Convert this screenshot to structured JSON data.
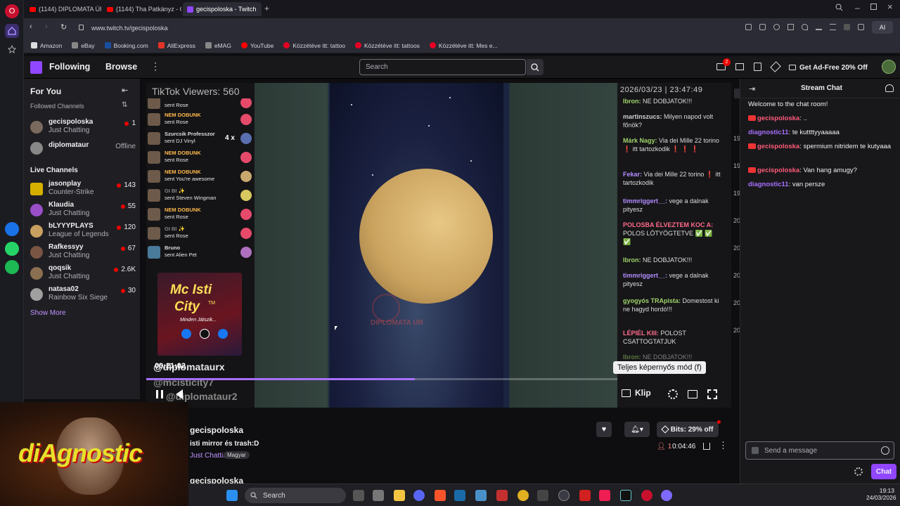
{
  "browser": {
    "tabs": [
      {
        "label": "(1144) DIPLOMATA ÚR - Y"
      },
      {
        "label": "(1144) Tha Patkányz - Gor"
      },
      {
        "label": "gecispoloska - Twitch"
      }
    ],
    "url": "www.twitch.tv/gecispoloska",
    "bookmarks": [
      "Amazon",
      "eBay",
      "Booking.com",
      "AliExpress",
      "eMAG",
      "YouTube",
      "Közzétéve itt: tattoo",
      "Közzétéve itt: tattoos",
      "Közzétéve itt: Mes e..."
    ],
    "toolbar_ai": "AI"
  },
  "twitch_nav": {
    "following": "Following",
    "browse": "Browse",
    "search_placeholder": "Search",
    "notif_count": "2",
    "ad_free": "Get Ad-Free 20% Off"
  },
  "sidebar": {
    "for_you": "For You",
    "followed_header": "Followed Channels",
    "followed": [
      {
        "name": "gecispoloska",
        "game": "Just Chatting",
        "viewers": "1",
        "color": "#7a6a5e"
      },
      {
        "name": "diplomataur",
        "game": "",
        "viewers": "Offline",
        "color": "#888888"
      }
    ],
    "live_header": "Live Channels",
    "live": [
      {
        "name": "jasonplay",
        "game": "Counter-Strike",
        "viewers": "143",
        "color": "#d6b000"
      },
      {
        "name": "Klaudia",
        "game": "Just Chatting",
        "viewers": "55",
        "color": "#9a4fc9"
      },
      {
        "name": "bLYYYPLAYS",
        "game": "League of Legends",
        "viewers": "120",
        "color": "#c9a060"
      },
      {
        "name": "Rafkessyy",
        "game": "Just Chatting",
        "viewers": "67",
        "color": "#7a5544"
      },
      {
        "name": "qoqsik",
        "game": "Just Chatting",
        "viewers": "2.6K",
        "color": "#8a7050"
      },
      {
        "name": "natasa02",
        "game": "Rainbow Six Siege",
        "viewers": "30",
        "color": "#a0a0a0"
      }
    ],
    "show_more": "Show More"
  },
  "player": {
    "tiktok_viewers": "TikTok Viewers: 560",
    "datetime": "2026/03/23 | 23:47:49",
    "gifts": [
      {
        "name": "",
        "text": "sent Rose"
      },
      {
        "name": "NEM DOBUNK",
        "text": "sent Rose"
      },
      {
        "name": "Szurcsik Professzor",
        "text": "sent DJ Vinyl",
        "count": "4 x"
      },
      {
        "name": "NEM DOBUNK",
        "text": "sent Rose"
      },
      {
        "name": "NEM DOBUNK",
        "text": "sent You're awesome"
      },
      {
        "name": "GI BI ✨",
        "text": "sent Steven Wingman"
      },
      {
        "name": "NEM DOBUNK",
        "text": "sent Rose"
      },
      {
        "name": "GI BI ✨",
        "text": "sent Rose"
      },
      {
        "name": "Bruno",
        "text": "sent Alien Pet"
      }
    ],
    "promo_title_1": "Mc Isti",
    "promo_title_2": "City",
    "promo_tm": "TM",
    "promo_sub": "Minden Játszik...",
    "handle1": "@diplomataurx",
    "handle2": "@mcisticity7",
    "handle3": "@diplomataur2",
    "timer": "00:21:02",
    "watermark": "DIPLOMATA ÚR",
    "progress_pct": 57,
    "overlay_chat": [
      {
        "user": "Ibron:",
        "text": "NE DOBJATOK!!!",
        "ucolor": "#9fd36b"
      },
      {
        "user": "martinszucs:",
        "text": "Milyen napod volt főnök?",
        "ucolor": "#cfcfcf"
      },
      {
        "user": "Márk Nagy:",
        "text": "Via dei Mille 22 torino ❗ itt tartozkodik ❗ ❗ ❗",
        "ucolor": "#9fd36b"
      },
      {
        "user": "Fekar:",
        "text": "Via dei Mille 22 torino ❗ itt tartozkodik",
        "ucolor": "#b38cff"
      },
      {
        "user": "timmriggert__:",
        "text": "vege a dalnak pityesz",
        "ucolor": "#b38cff"
      },
      {
        "user": "POLOSBA ÉLVEZTEM KOC A:",
        "text": "POLOS LÖTYÖGTETVE ✅ ✅ ✅",
        "ucolor": "#ff6a8a"
      },
      {
        "user": "Ibron:",
        "text": "NE DOBJATOK!!!",
        "ucolor": "#9fd36b"
      },
      {
        "user": "timmriggert__:",
        "text": "vege a dalnak pityesz",
        "ucolor": "#b38cff"
      },
      {
        "user": "gyogyós TRApista:",
        "text": "Domestost ki ne hagyd hordó!!!",
        "ucolor": "#9fd36b"
      },
      {
        "user": "LÉPIÉL KIII:",
        "text": "POLOST CSATTOGTATJUK",
        "ucolor": "#ff6a8a"
      },
      {
        "user": "Ibron:",
        "text": "NE DOBJATOK!!!",
        "ucolor": "#9fd36b"
      }
    ],
    "tooltip": "Teljes képernyős mód (f)",
    "klip": "Klip"
  },
  "stream_info": {
    "channel": "gecispoloska",
    "title": "isti mirror és trash:D",
    "category": "Just Chatting",
    "tag": "Magyar",
    "bits": "Bits: 29% off",
    "viewers": "1",
    "uptime": "0:04:46",
    "channel2": "gecispoloska"
  },
  "chat": {
    "title": "Stream Chat",
    "welcome": "Welcome to the chat room!",
    "messages": [
      {
        "user": "gecispoloska",
        "text": ": ..",
        "broadcaster": true
      },
      {
        "user": "diagnostic11",
        "text": ": te kuttttyyaaaaa",
        "broadcaster": false
      },
      {
        "user": "gecispoloska",
        "text": ": spermium nitridem te kutyaaa",
        "broadcaster": true
      },
      {
        "user": "gecispoloska",
        "text": ": Van hang amugy?",
        "broadcaster": true
      },
      {
        "user": "diagnostic11",
        "text": ": van persze",
        "broadcaster": false
      }
    ],
    "input_placeholder": "Send a message",
    "send": "Chat",
    "partial_nums": [
      "19",
      "19",
      "19",
      "20",
      "20",
      "20",
      "20",
      "20"
    ]
  },
  "webcam": {
    "overlay_text": "diAgnostic"
  },
  "taskbar": {
    "search": "Search",
    "time": "19:13",
    "date": "24/03/2026"
  }
}
